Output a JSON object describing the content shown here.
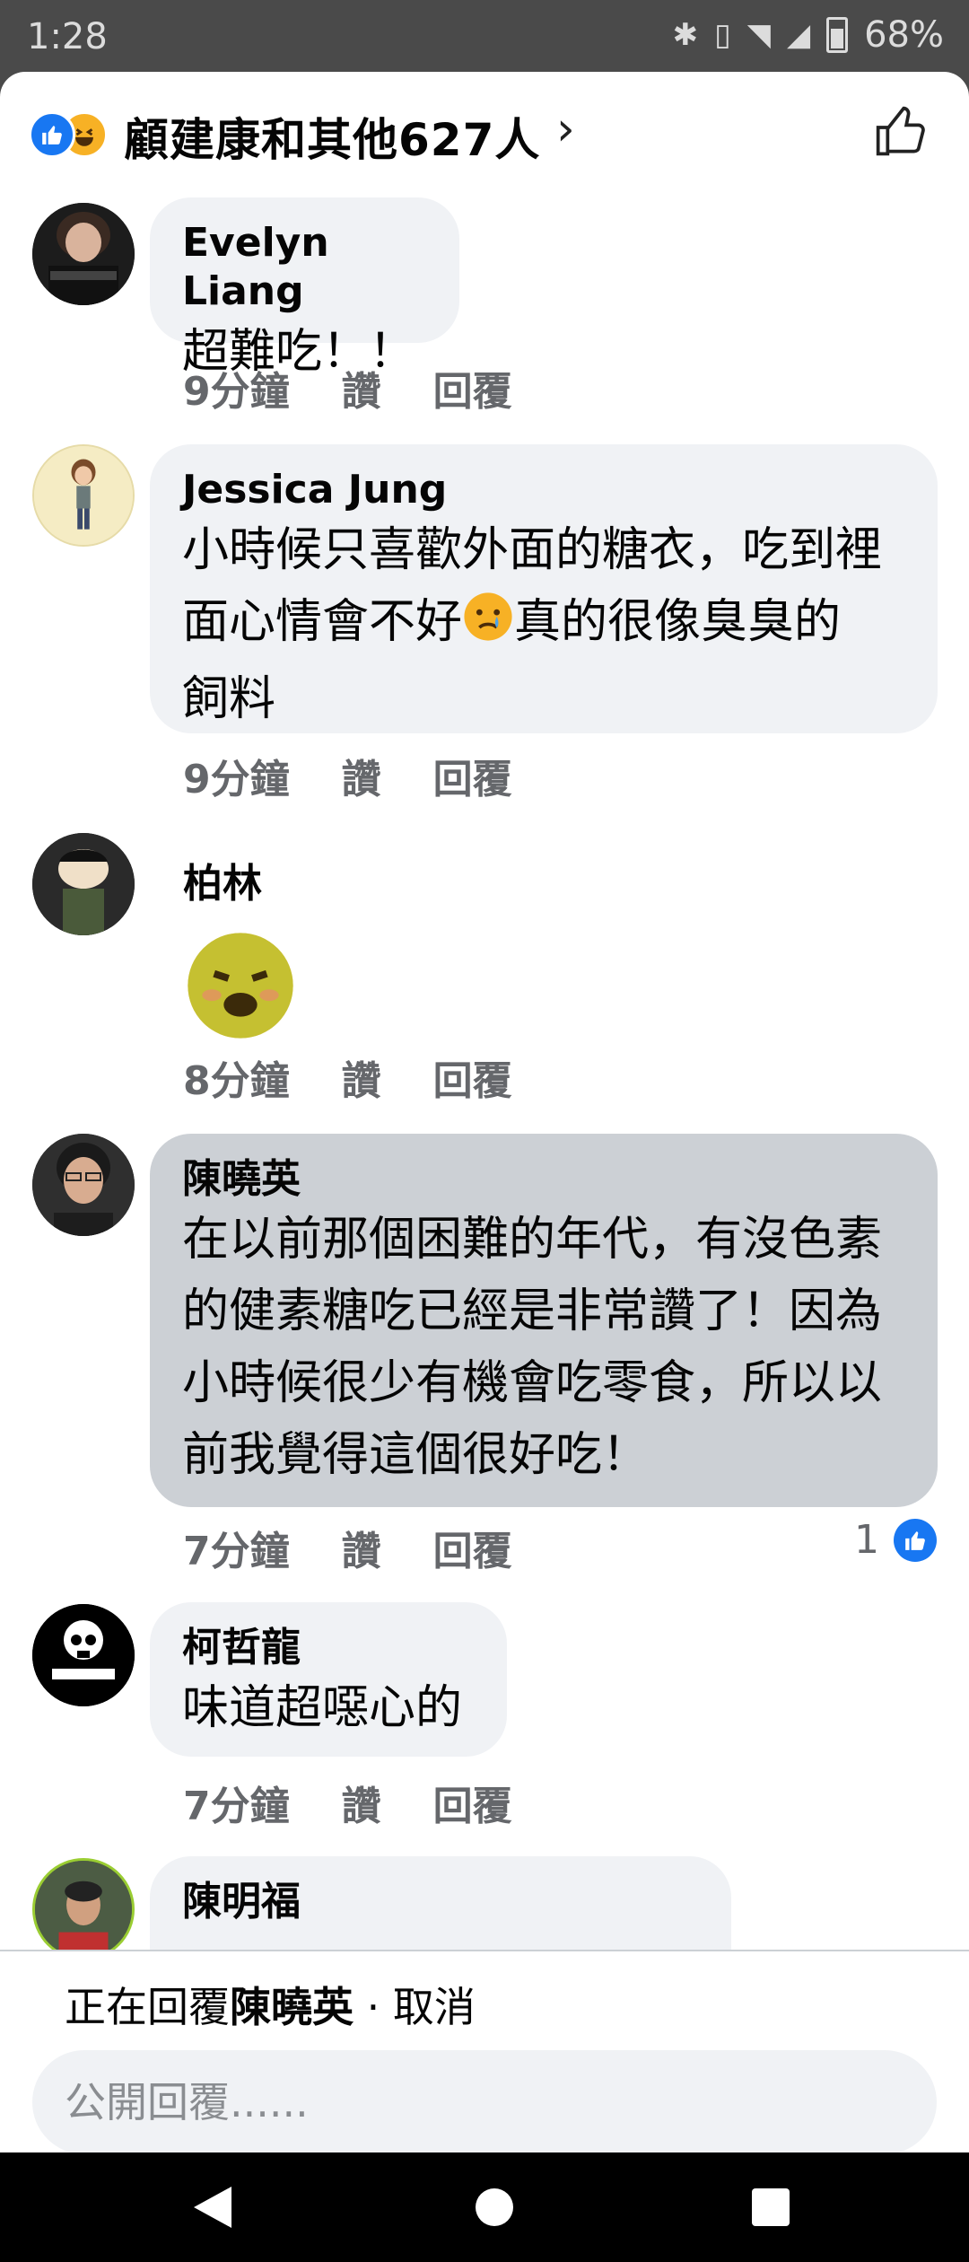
{
  "status_bar": {
    "time": "1:28",
    "battery": "68%"
  },
  "header": {
    "title": "顧建康和其他627人"
  },
  "comments": [
    {
      "author": "Evelyn Liang",
      "text": [
        "超難吃！！"
      ],
      "time": "9分鐘",
      "like": "讚",
      "reply": "回覆"
    },
    {
      "author": "Jessica Jung",
      "text": [
        "小時候只喜歡外面的糖衣，吃到裡",
        "面心情會不好￼",
        "真的很像臭臭的",
        "飼料￼"
      ],
      "time": "9分鐘",
      "like": "讚",
      "reply": "回覆"
    },
    {
      "author": "柏林",
      "time": "8分鐘",
      "like": "讚",
      "reply": "回覆"
    },
    {
      "author": "陳曉英",
      "text": [
        "在以前那個困難的年代，有沒色素",
        "的健素糖吃已經是非常讚了！因為",
        "小時候很少有機會吃零食，所以以",
        "前我覺得這個很好吃！"
      ],
      "time": "7分鐘",
      "like": "讚",
      "reply": "回覆",
      "reactions": "1"
    },
    {
      "author": "柯哲龍",
      "text": [
        "味道超噁心的"
      ],
      "time": "7分鐘",
      "like": "讚",
      "reply": "回覆"
    },
    {
      "author": "陳明福"
    }
  ],
  "reply_bar": {
    "prefix": "正在回覆",
    "name": "陳曉英",
    "separator": " · ",
    "cancel": "取消",
    "placeholder": "公開回覆......"
  },
  "colors": {
    "accent": "#1877f2",
    "bubble": "#f0f2f5",
    "bubble_highlight": "#ccd0d5",
    "meta": "#65676b"
  },
  "icons": [
    "bluetooth-icon",
    "vibrate-icon",
    "wifi-icon",
    "signal-icon",
    "battery-icon",
    "like-reaction-icon",
    "haha-reaction-icon",
    "chevron-right-icon",
    "thumbs-up-icon",
    "back-icon",
    "home-icon",
    "recents-icon"
  ]
}
